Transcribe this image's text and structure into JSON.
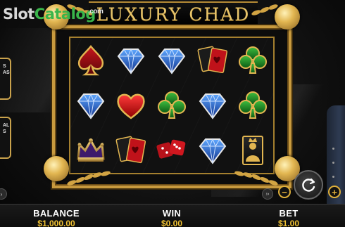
{
  "watermark": {
    "brand_a": "Slot",
    "brand_b": "Catalog",
    "suffix": ".com"
  },
  "game": {
    "title": "LUXURY CHAD"
  },
  "reels": [
    [
      "spade",
      "diamond",
      "diamond",
      "cards",
      "club"
    ],
    [
      "diamond",
      "heart",
      "club",
      "diamond",
      "club"
    ],
    [
      "crown",
      "cards",
      "dice",
      "diamond",
      "joker"
    ]
  ],
  "side_panels": [
    {
      "line1": "S",
      "line2": "AS"
    },
    {
      "line1": "AL",
      "line2": "S"
    }
  ],
  "controls": {
    "minus_label": "−",
    "plus_label": "+",
    "spin_icon": "refresh-icon",
    "speed_label": "››",
    "left_btn_label": "›"
  },
  "stats": {
    "balance_label": "BALANCE",
    "balance_value": "$1,000.00",
    "win_label": "WIN",
    "win_value": "$0.00",
    "bet_label": "BET",
    "bet_value": "$1.00"
  },
  "colors": {
    "gold": "#c89a3e",
    "gold_light": "#e7c46b",
    "value_yellow": "#f1c232",
    "watermark_green": "#39b54a"
  }
}
